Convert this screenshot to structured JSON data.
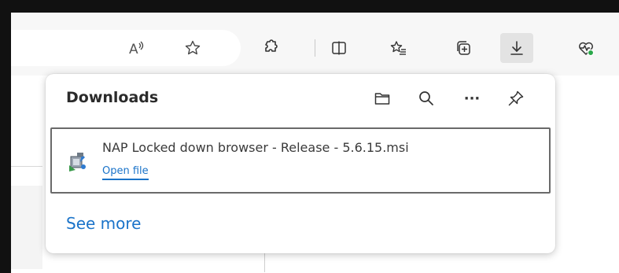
{
  "toolbar": {
    "icons": [
      {
        "name": "read-aloud-icon",
        "label": "A"
      },
      {
        "name": "favorite-star-icon"
      },
      {
        "name": "extensions-puzzle-icon"
      },
      {
        "name": "split-screen-icon"
      },
      {
        "name": "favorites-list-icon"
      },
      {
        "name": "collections-icon"
      },
      {
        "name": "downloads-icon",
        "active": true
      },
      {
        "name": "browser-essentials-heart-icon"
      }
    ],
    "read_aloud_glyph": "A"
  },
  "downloads_panel": {
    "title": "Downloads",
    "header_icons": [
      "folder-icon",
      "search-icon",
      "more-options-icon",
      "pin-icon"
    ],
    "more_glyph": "···",
    "items": [
      {
        "file_name": "NAP Locked down browser - Release - 5.6.15.msi",
        "action_label": "Open file",
        "file_icon": "installer-package-icon"
      }
    ],
    "see_more_label": "See more"
  },
  "colors": {
    "link": "#1a73c9",
    "active_button_bg": "#e3e3e3",
    "essentials_badge": "#2aa84a"
  }
}
